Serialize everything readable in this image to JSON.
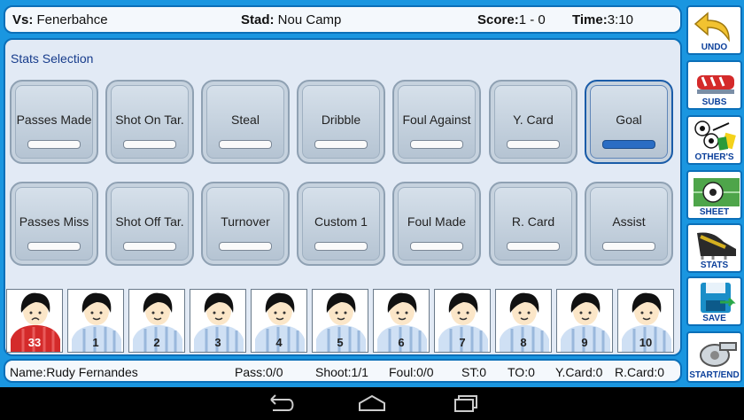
{
  "header": {
    "vs_label": "Vs:",
    "vs_value": "Fenerbahce",
    "stad_label": "Stad:",
    "stad_value": "Nou Camp",
    "score_label": "Score:",
    "score_value": "1 - 0",
    "time_label": "Time:",
    "time_value": "3:10"
  },
  "panel": {
    "title": "Stats Selection"
  },
  "stats_row1": [
    "Passes Made",
    "Shot On Tar.",
    "Steal",
    "Dribble",
    "Foul Against",
    "Y. Card",
    "Goal"
  ],
  "stats_row2": [
    "Passes Miss",
    "Shot Off Tar.",
    "Turnover",
    "Custom 1",
    "Foul Made",
    "R. Card",
    "Assist"
  ],
  "selected_stat": "Goal",
  "players": [
    "33",
    "1",
    "2",
    "3",
    "4",
    "5",
    "6",
    "7",
    "8",
    "9",
    "10"
  ],
  "selected_player": "33",
  "status": {
    "name": "Name:Rudy Fernandes",
    "pass": "Pass:0/0",
    "shoot": "Shoot:1/1",
    "foul": "Foul:0/0",
    "st": "ST:0",
    "to": "TO:0",
    "ycard": "Y.Card:0",
    "rcard": "R.Card:0"
  },
  "side_menu": [
    "UNDO",
    "SUBS",
    "OTHER'S",
    "SHEET",
    "STATS",
    "SAVE",
    "START/END"
  ],
  "colors": {
    "accent": "#1a96e0",
    "border": "#0b6fb8",
    "selected_player": "#d42a2a",
    "active_bar": "#2a6dc4"
  }
}
